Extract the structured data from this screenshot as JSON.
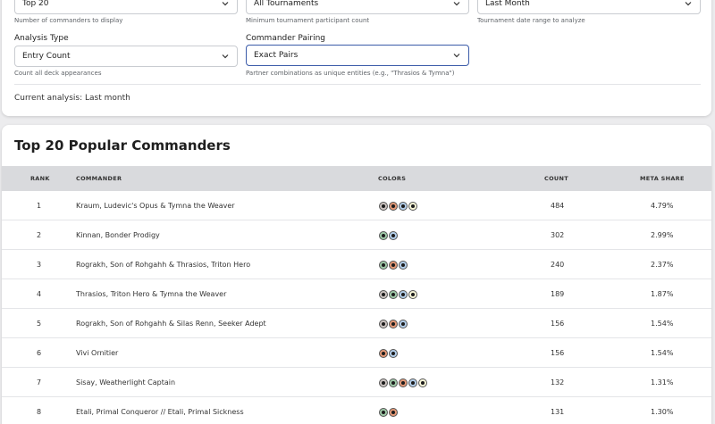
{
  "filters": {
    "top": {
      "value": "Top 20",
      "helper": "Number of commanders to display"
    },
    "tournaments": {
      "value": "All Tournaments",
      "helper": "Minimum tournament participant count"
    },
    "date_range": {
      "value": "Last Month",
      "helper": "Tournament date range to analyze"
    },
    "analysis_type": {
      "label": "Analysis Type",
      "value": "Entry Count",
      "helper": "Count all deck appearances"
    },
    "pairing": {
      "label": "Commander Pairing",
      "value": "Exact Pairs",
      "helper": "Partner combinations as unique entities (e.g., \"Thrasios & Tymna\")"
    },
    "current_analysis": "Current analysis: Last month"
  },
  "table": {
    "title": "Top 20 Popular Commanders",
    "headers": {
      "rank": "RANK",
      "commander": "COMMANDER",
      "colors": "COLORS",
      "count": "COUNT",
      "meta_share": "META SHARE"
    },
    "rows": [
      {
        "rank": "1",
        "commander": "Kraum, Ludevic's Opus & Tymna the Weaver",
        "colors": [
          "B",
          "R",
          "U",
          "W"
        ],
        "count": "484",
        "meta_share": "4.79%"
      },
      {
        "rank": "2",
        "commander": "Kinnan, Bonder Prodigy",
        "colors": [
          "G",
          "U"
        ],
        "count": "302",
        "meta_share": "2.99%"
      },
      {
        "rank": "3",
        "commander": "Rograkh, Son of Rohgahh & Thrasios, Triton Hero",
        "colors": [
          "G",
          "R",
          "U"
        ],
        "count": "240",
        "meta_share": "2.37%"
      },
      {
        "rank": "4",
        "commander": "Thrasios, Triton Hero & Tymna the Weaver",
        "colors": [
          "B",
          "G",
          "U",
          "W"
        ],
        "count": "189",
        "meta_share": "1.87%"
      },
      {
        "rank": "5",
        "commander": "Rograkh, Son of Rohgahh & Silas Renn, Seeker Adept",
        "colors": [
          "B",
          "R",
          "U"
        ],
        "count": "156",
        "meta_share": "1.54%"
      },
      {
        "rank": "6",
        "commander": "Vivi Ornitier",
        "colors": [
          "R",
          "U"
        ],
        "count": "156",
        "meta_share": "1.54%"
      },
      {
        "rank": "7",
        "commander": "Sisay, Weatherlight Captain",
        "colors": [
          "B",
          "G",
          "R",
          "U",
          "W"
        ],
        "count": "132",
        "meta_share": "1.31%"
      },
      {
        "rank": "8",
        "commander": "Etali, Primal Conqueror // Etali, Primal Sickness",
        "colors": [
          "G",
          "R"
        ],
        "count": "131",
        "meta_share": "1.30%"
      }
    ]
  },
  "colors": {
    "accent": "#3b5ba9",
    "header_bg": "#d9dadd",
    "page_bg": "#ececee"
  }
}
